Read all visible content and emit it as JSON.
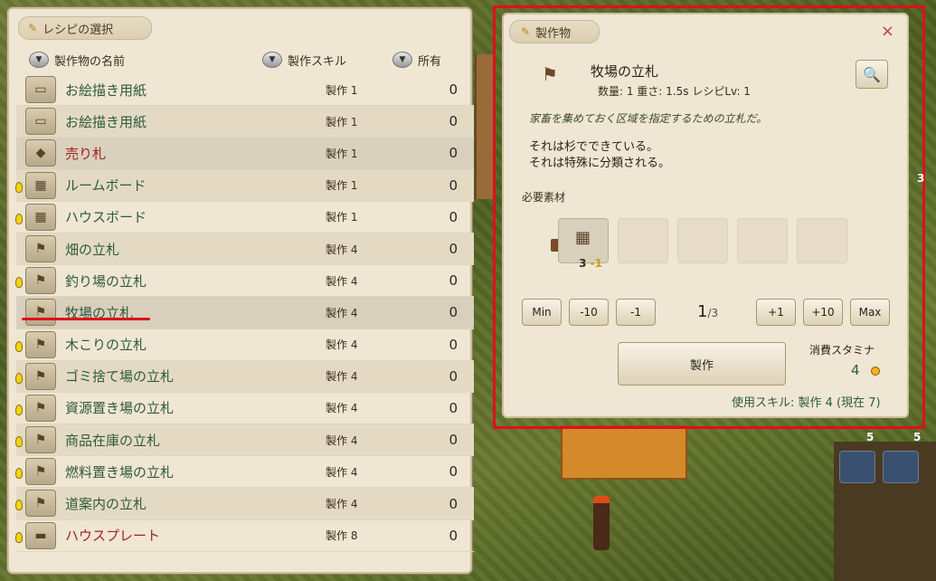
{
  "recipe_panel": {
    "title": "レシピの選択",
    "columns": {
      "name": "製作物の名前",
      "skill": "製作スキル",
      "owned": "所有"
    },
    "rows": [
      {
        "name": "お絵描き用紙",
        "skill": "製作 1",
        "owned": "0",
        "bulb": false,
        "red": false
      },
      {
        "name": "お絵描き用紙",
        "skill": "製作 1",
        "owned": "0",
        "bulb": false,
        "red": false
      },
      {
        "name": "売り札",
        "skill": "製作 1",
        "owned": "0",
        "bulb": false,
        "red": true
      },
      {
        "name": "ルームボード",
        "skill": "製作 1",
        "owned": "0",
        "bulb": true,
        "red": false
      },
      {
        "name": "ハウスボード",
        "skill": "製作 1",
        "owned": "0",
        "bulb": true,
        "red": false
      },
      {
        "name": "畑の立札",
        "skill": "製作 4",
        "owned": "0",
        "bulb": false,
        "red": false
      },
      {
        "name": "釣り場の立札",
        "skill": "製作 4",
        "owned": "0",
        "bulb": true,
        "red": false
      },
      {
        "name": "牧場の立札",
        "skill": "製作 4",
        "owned": "0",
        "bulb": false,
        "red": false
      },
      {
        "name": "木こりの立札",
        "skill": "製作 4",
        "owned": "0",
        "bulb": true,
        "red": false
      },
      {
        "name": "ゴミ捨て場の立札",
        "skill": "製作 4",
        "owned": "0",
        "bulb": true,
        "red": false
      },
      {
        "name": "資源置き場の立札",
        "skill": "製作 4",
        "owned": "0",
        "bulb": true,
        "red": false
      },
      {
        "name": "商品在庫の立札",
        "skill": "製作 4",
        "owned": "0",
        "bulb": true,
        "red": false
      },
      {
        "name": "燃料置き場の立札",
        "skill": "製作 4",
        "owned": "0",
        "bulb": true,
        "red": false
      },
      {
        "name": "道案内の立札",
        "skill": "製作 4",
        "owned": "0",
        "bulb": true,
        "red": false
      },
      {
        "name": "ハウスプレート",
        "skill": "製作 8",
        "owned": "0",
        "bulb": true,
        "red": true
      }
    ]
  },
  "craft_panel": {
    "title": "製作物",
    "close": "×",
    "item_name": "牧場の立札",
    "meta": "数量: 1  重さ: 1.5s  レシピLv: 1",
    "description": "家畜を集めておく区域を指定するための立札だ。",
    "detail_line1": "それは杉でできている。",
    "detail_line2": "それは特殊に分類される。",
    "materials_label": "必要素材",
    "material_count": "3",
    "material_need": "-1",
    "buttons": {
      "min": "Min",
      "m10": "-10",
      "m1": "-1",
      "p1": "+1",
      "p10": "+10",
      "max": "Max"
    },
    "quantity": "1",
    "quantity_max": "/3",
    "craft_button": "製作",
    "stamina_label": "消費スタミナ",
    "stamina_value": "4",
    "skill_used": "使用スキル: 製作 4 (現在 7)"
  },
  "hud": {
    "slot_count_a": "5",
    "slot_count_b": "5",
    "side_number": "3"
  },
  "colors": {
    "highlight_border": "#e20e1c",
    "name_green": "#2e5a3c",
    "name_red": "#a02424"
  }
}
